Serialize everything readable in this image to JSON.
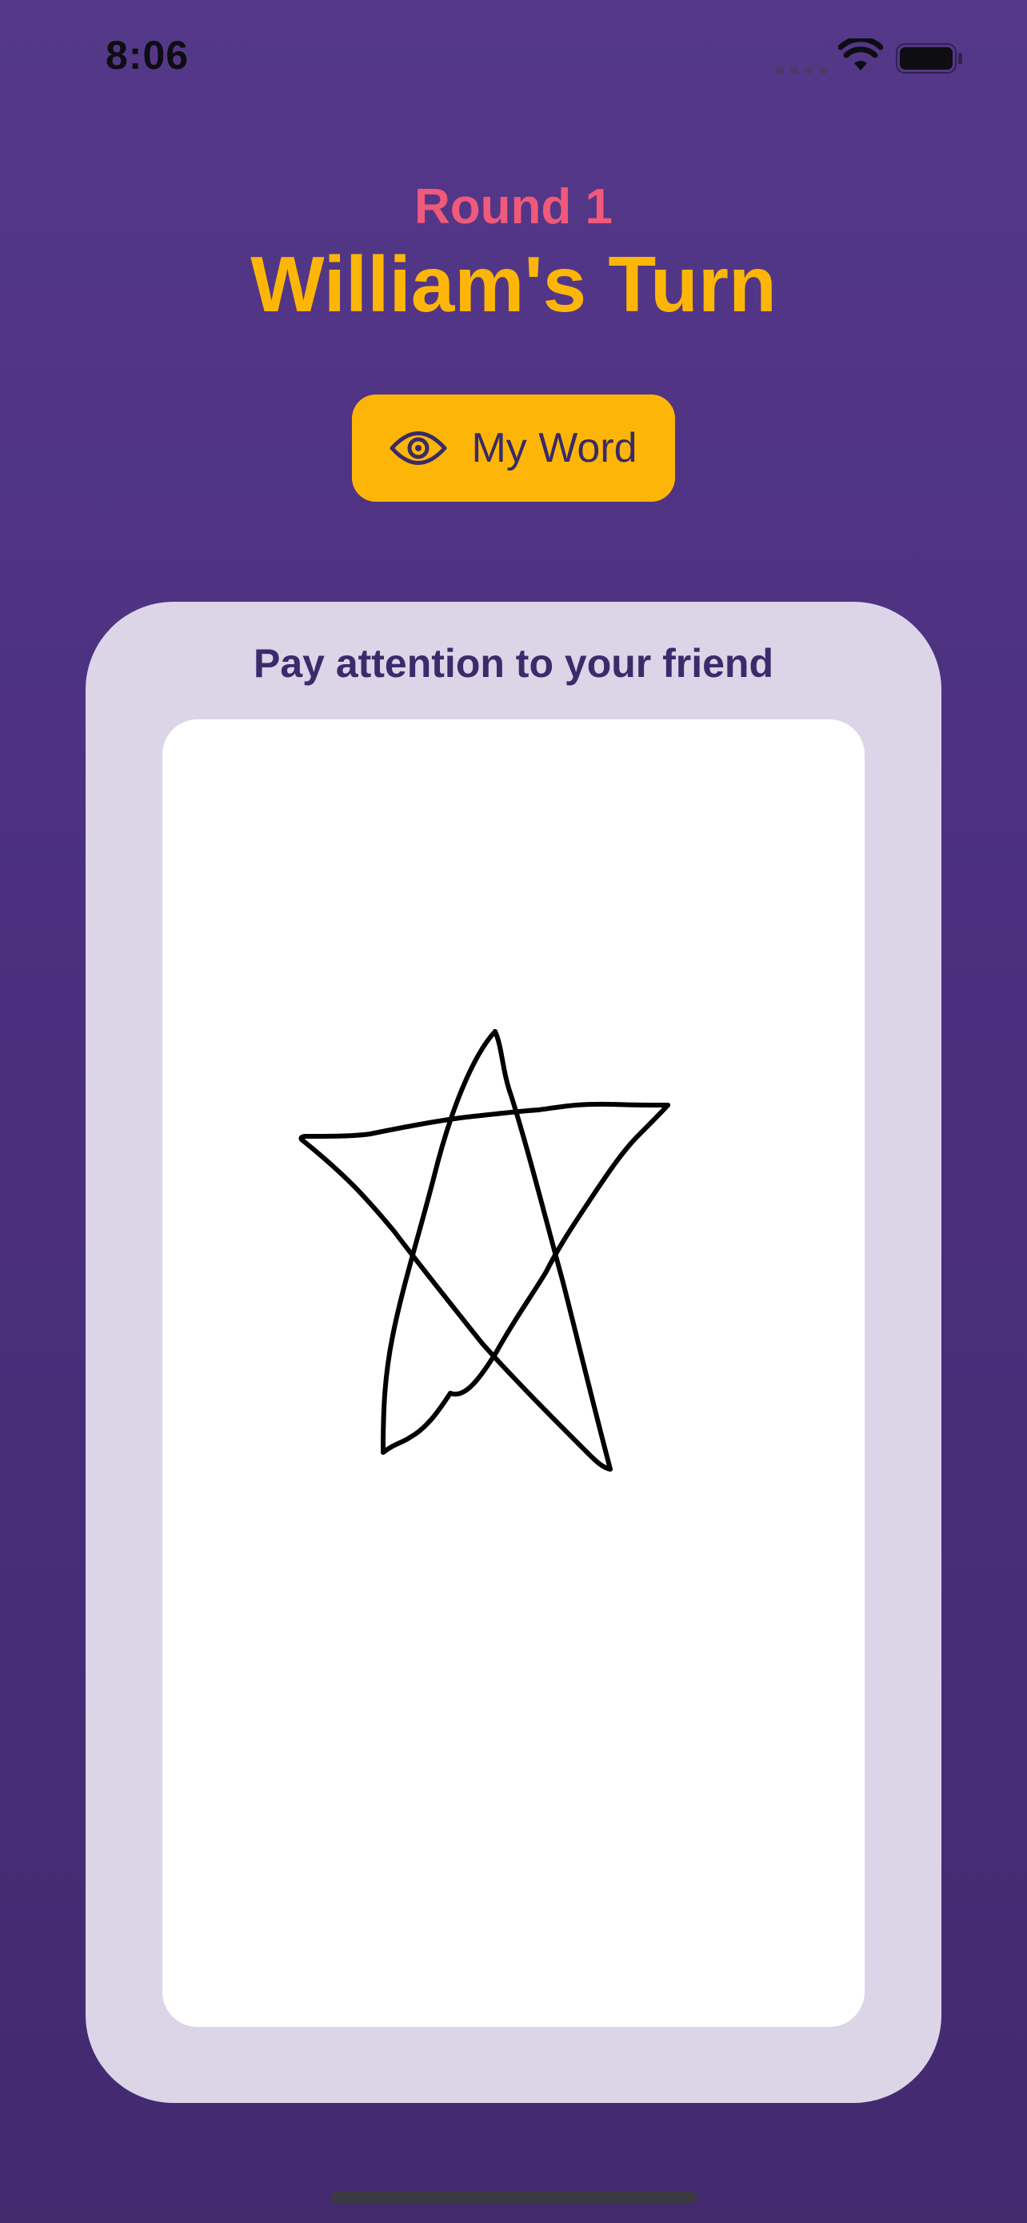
{
  "status_bar": {
    "time": "8:06",
    "icons": [
      "cellular-signal-icon",
      "wifi-icon",
      "battery-icon"
    ]
  },
  "header": {
    "round": "Round 1",
    "turn": "William's Turn"
  },
  "word_button": {
    "label": "My Word",
    "icon": "eye-icon"
  },
  "card": {
    "title": "Pay attention to your friend"
  },
  "drawing": {
    "subject_icon": "star-sketch",
    "stroke_color": "#000000"
  },
  "colors": {
    "background": "#4b2f7e",
    "round_text": "#f0597a",
    "turn_text": "#fdb607",
    "button": "#fdb607",
    "card": "#dcd5e8",
    "card_title": "#3d2a6a",
    "canvas": "#ffffff"
  }
}
